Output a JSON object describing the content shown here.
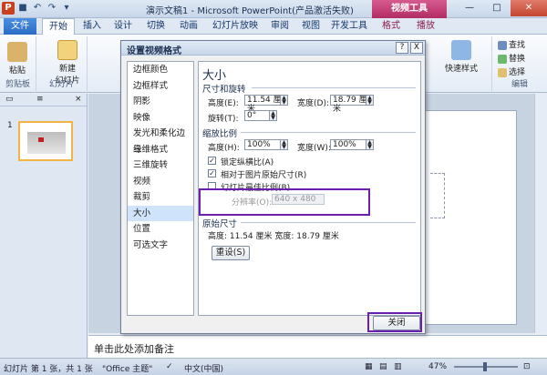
{
  "window": {
    "title": "演示文稿1 - Microsoft PowerPoint(产品激活失败)",
    "context_tab": "视频工具",
    "app_icon": "P"
  },
  "tabs": [
    "文件",
    "开始",
    "插入",
    "设计",
    "切换",
    "动画",
    "幻灯片放映",
    "审阅",
    "视图",
    "开发工具",
    "格式",
    "播放"
  ],
  "ribbon": {
    "paste": "粘贴",
    "clipboard": "剪贴板",
    "new_slide": "新建",
    "new_slide2": "幻灯片",
    "slides_group": "幻灯片",
    "quick_styles": "快速样式",
    "find": "查找",
    "replace": "替换",
    "select": "选择",
    "editing": "编辑"
  },
  "leftpane": {
    "slide_number": "1"
  },
  "notes": {
    "placeholder": "单击此处添加备注"
  },
  "status": {
    "slide_info": "幻灯片 第 1 张，共 1 张",
    "theme": "\"Office 主题\"",
    "language": "中文(中国)",
    "zoom": "47%"
  },
  "dialog": {
    "title": "设置视频格式",
    "nav": [
      "边框颜色",
      "边框样式",
      "阴影",
      "映像",
      "发光和柔化边缘",
      "三维格式",
      "三维旋转",
      "视频",
      "裁剪",
      "大小",
      "位置",
      "可选文字"
    ],
    "selected_nav": "大小",
    "heading": "大小",
    "size_rotate": "尺寸和旋转",
    "height_label": "高度(E):",
    "height_value": "11.54 厘米",
    "width_label": "宽度(D):",
    "width_value": "18.79 厘米",
    "rotation_label": "旋转(T):",
    "rotation_value": "0°",
    "scale": "缩放比例",
    "scale_height_label": "高度(H):",
    "scale_height_value": "100%",
    "scale_width_label": "宽度(W):",
    "scale_width_value": "100%",
    "lock_aspect": "锁定纵横比(A)",
    "relative_original": "相对于图片原始尺寸(R)",
    "best_scale": "幻灯片最佳比例(B)",
    "resolution_label": "分辨率(O):",
    "resolution_value": "640 x 480",
    "original_size": "原始尺寸",
    "original_values": "高度:  11.54 厘米   宽度:  18.79 厘米",
    "reset": "重设(S)",
    "close": "关闭",
    "help": "?",
    "x": "X"
  }
}
